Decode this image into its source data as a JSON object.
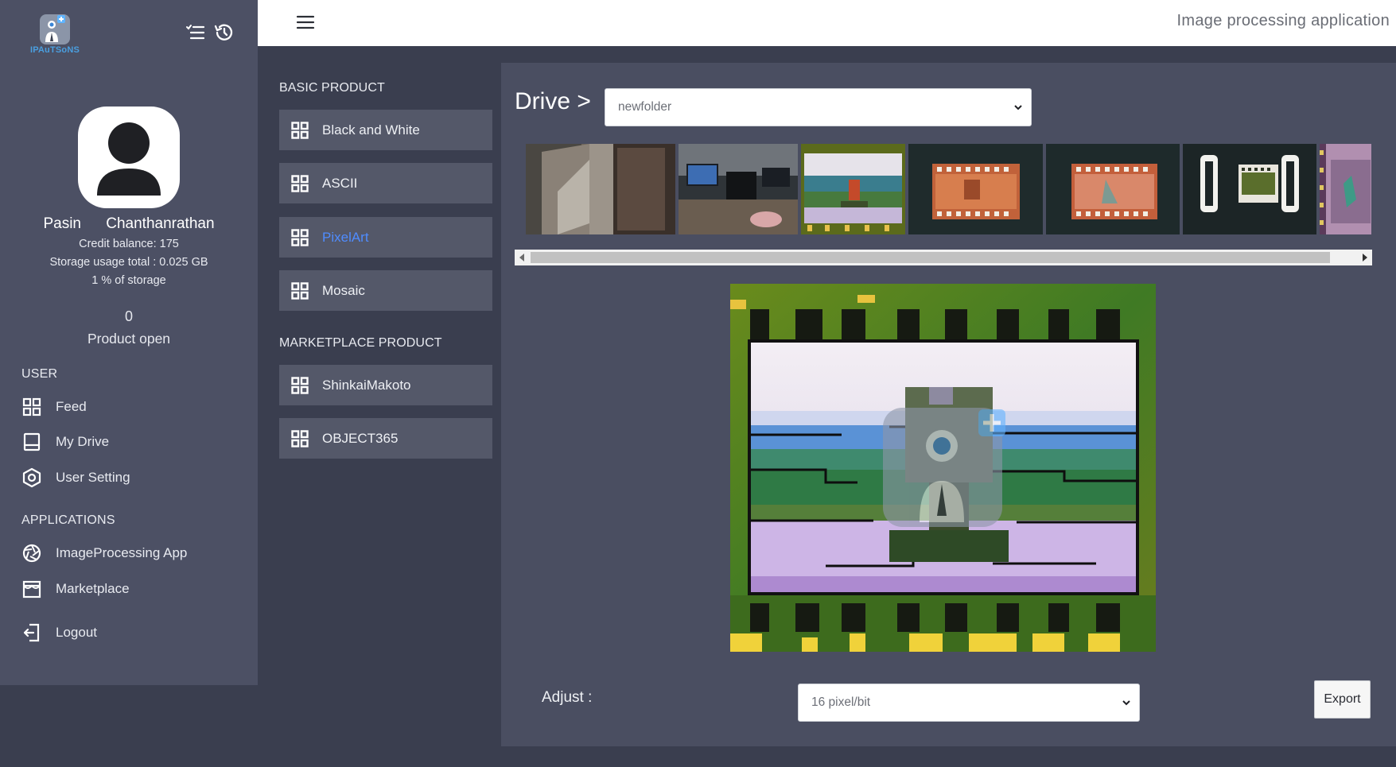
{
  "sidebar": {
    "logo_text": "IPAuTSoNS",
    "user": {
      "name": "Pasin Chanthanrathan",
      "credit": "Credit balance: 175",
      "storage": "Storage usage total : 0.025 GB",
      "storage_percent": "1 % of storage",
      "product_count": "0",
      "product_open": "Product open"
    },
    "user_section": "USER",
    "user_items": [
      {
        "label": "Feed",
        "icon": "grid-icon"
      },
      {
        "label": "My Drive",
        "icon": "drive-icon"
      },
      {
        "label": "User Setting",
        "icon": "settings-icon"
      }
    ],
    "apps_section": "APPLICATIONS",
    "app_items": [
      {
        "label": "ImageProcessing App",
        "icon": "aperture-icon"
      },
      {
        "label": "Marketplace",
        "icon": "store-icon"
      }
    ],
    "logout_label": "Logout"
  },
  "topbar": {
    "title": "Image processing application"
  },
  "products": {
    "basic_section": "BASIC PRODUCT",
    "basic": [
      "Black and White",
      "ASCII",
      "PixelArt",
      "Mosaic"
    ],
    "active": "PixelArt",
    "marketplace_section": "MARKETPLACE PRODUCT",
    "marketplace": [
      "ShinkaiMakoto",
      "OBJECT365"
    ]
  },
  "main": {
    "drive_label": "Drive >",
    "folder_select": "newfolder",
    "adjust_label": "Adjust :",
    "adjust_select": "16 pixel/bit",
    "export_label": "Export"
  },
  "colors": {
    "sidebar_bg": "#4c5064",
    "page_bg": "#3a3e4f",
    "panel_bg": "#4a4e61",
    "product_btn_bg": "#545869",
    "active_accent": "#4f8cff"
  }
}
